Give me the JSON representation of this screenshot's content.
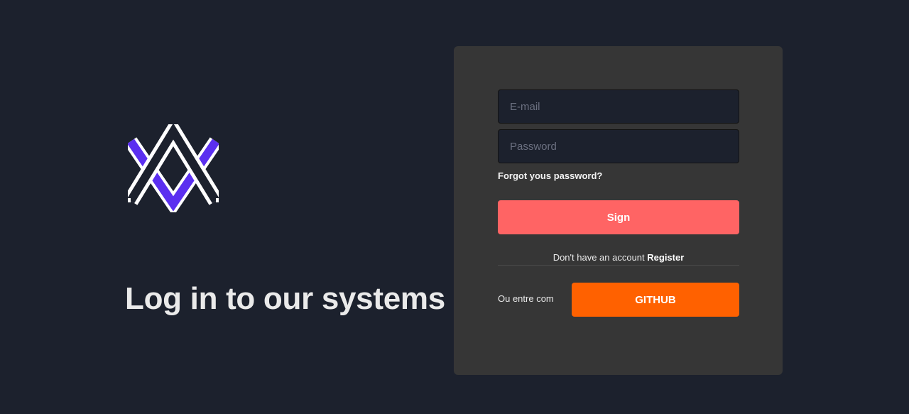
{
  "brand": {
    "logo_icon": "logo-icon",
    "accent_color": "#5b2ff0",
    "headline": "Log in to our systems"
  },
  "login": {
    "email_placeholder": "E-mail",
    "email_value": "",
    "password_placeholder": "Password",
    "password_value": "",
    "forgot_label": "Forgot yous password?",
    "sign_label": "Sign",
    "sign_color": "#ff6464",
    "no_account_text": "Don't have an account",
    "register_label": "Register",
    "alt_login_label": "Ou entre com",
    "github_label": "GITHUB",
    "github_color": "#ff6100"
  }
}
